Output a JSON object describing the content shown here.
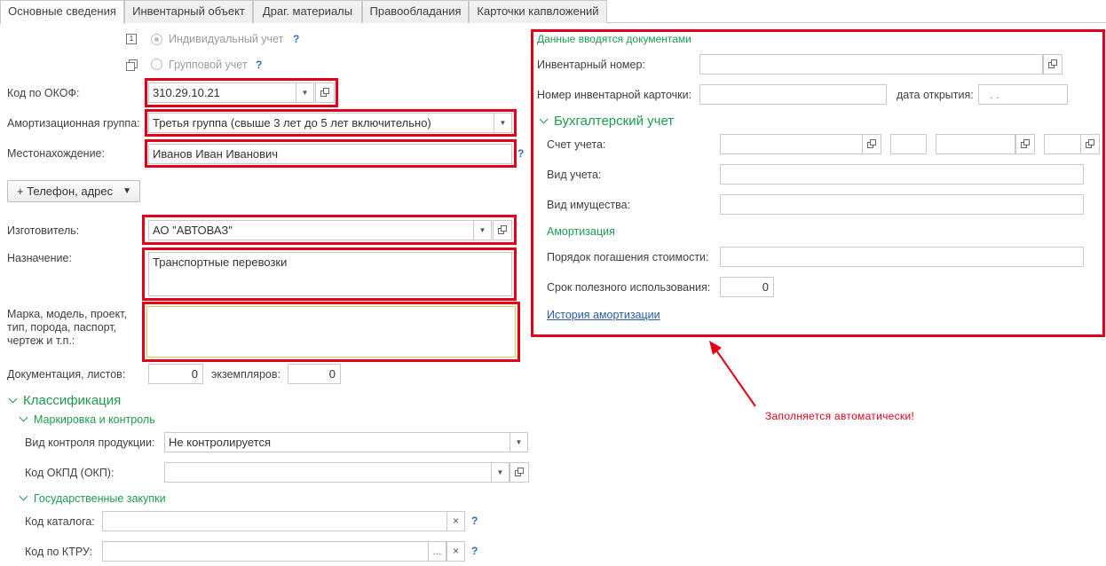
{
  "tabs": [
    {
      "label": "Основные сведения"
    },
    {
      "label": "Инвентарный объект"
    },
    {
      "label": "Драг. материалы"
    },
    {
      "label": "Правообладания"
    },
    {
      "label": "Карточки капвложений"
    }
  ],
  "accounting_mode": {
    "individual_label": "Индивидуальный учет",
    "group_label": "Групповой учет",
    "help": "?"
  },
  "left": {
    "okof_label": "Код по ОКОФ:",
    "okof_value": "310.29.10.21",
    "amort_group_label": "Амортизационная группа:",
    "amort_group_value": "Третья группа (свыше 3 лет до 5 лет включительно)",
    "location_label": "Местонахождение:",
    "location_value": "Иванов Иван Иванович",
    "location_help": "?",
    "phone_button": "+ Телефон, адрес",
    "manufacturer_label": "Изготовитель:",
    "manufacturer_value": "АО \"АВТОВАЗ\"",
    "purpose_label": "Назначение:",
    "purpose_value": "Транспортные перевозки",
    "brand_label_1": "Марка, модель, проект,",
    "brand_label_2": "тип, порода, паспорт,",
    "brand_label_3": "чертеж и т.п.:",
    "brand_value": "",
    "docs_label": "Документация, листов:",
    "docs_sheets": "0",
    "copies_label": "экземпляров:",
    "copies_value": "0"
  },
  "classification": {
    "title": "Классификация",
    "marking_title": "Маркировка и контроль",
    "control_label": "Вид контроля продукции:",
    "control_value": "Не контролируется",
    "okpd_label": "Код ОКПД (ОКП):",
    "okpd_value": "",
    "procurement_title": "Государственные закупки",
    "catalog_label": "Код каталога:",
    "catalog_value": "",
    "ktru_label": "Код по КТРУ:",
    "ktru_value": "",
    "clear_glyph": "×",
    "more_glyph": "...",
    "help": "?"
  },
  "right": {
    "docs_title": "Данные вводятся документами",
    "inv_number_label": "Инвентарный номер:",
    "inv_number_value": "",
    "inv_card_label": "Номер инвентарной карточки:",
    "inv_card_value": "",
    "open_date_label": "дата открытия:",
    "open_date_value": ". .",
    "accounting_title": "Бухгалтерский учет",
    "account_label": "Счет учета:",
    "account_type_label": "Вид учета:",
    "property_type_label": "Вид имущества:",
    "amortization_title": "Амортизация",
    "repayment_label": "Порядок погашения стоимости:",
    "useful_life_label": "Срок полезного использования:",
    "useful_life_value": "0",
    "history_link": "История амортизации"
  },
  "annotation": {
    "note": "Заполняется автоматически!"
  },
  "colors": {
    "highlight": "#e3001b",
    "section_green": "#1f9a4e",
    "link_blue": "#2a5aa8"
  }
}
